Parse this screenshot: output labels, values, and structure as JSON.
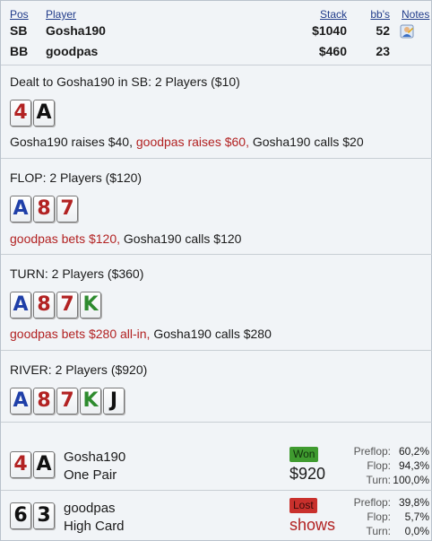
{
  "header": {
    "pos": "Pos",
    "player": "Player",
    "stack": "Stack",
    "bbs": "bb's",
    "notes": "Notes"
  },
  "players": [
    {
      "pos": "SB",
      "name": "Gosha190",
      "stack": "$1040",
      "bb": "52",
      "note_icon": "user-note-icon"
    },
    {
      "pos": "BB",
      "name": "goodpas",
      "stack": "$460",
      "bb": "23"
    }
  ],
  "preflop": {
    "title": "Dealt to Gosha190 in SB: 2 Players ($10)",
    "cards": [
      {
        "rank": "4",
        "color": "#b22222"
      },
      {
        "rank": "A",
        "color": "#111111"
      }
    ],
    "actions": [
      {
        "text": "Gosha190 raises $40, ",
        "who": "hero"
      },
      {
        "text": "goodpas raises $60, ",
        "who": "villain"
      },
      {
        "text": "Gosha190 calls $20",
        "who": "hero"
      }
    ]
  },
  "flop": {
    "title": "FLOP: 2 Players ($120)",
    "cards": [
      {
        "rank": "A",
        "color": "#1f3fa8"
      },
      {
        "rank": "8",
        "color": "#b22222"
      },
      {
        "rank": "7",
        "color": "#b22222"
      }
    ],
    "actions": [
      {
        "text": "goodpas bets $120, ",
        "who": "villain"
      },
      {
        "text": "Gosha190 calls $120",
        "who": "hero"
      }
    ]
  },
  "turn": {
    "title": "TURN: 2 Players ($360)",
    "cards": [
      {
        "rank": "A",
        "color": "#1f3fa8"
      },
      {
        "rank": "8",
        "color": "#b22222"
      },
      {
        "rank": "7",
        "color": "#b22222"
      },
      {
        "rank": "K",
        "color": "#2e8b2e"
      }
    ],
    "actions": [
      {
        "text": "goodpas bets $280 all-in, ",
        "who": "villain"
      },
      {
        "text": "Gosha190 calls $280",
        "who": "hero"
      }
    ]
  },
  "river": {
    "title": "RIVER: 2 Players ($920)",
    "cards": [
      {
        "rank": "A",
        "color": "#1f3fa8"
      },
      {
        "rank": "8",
        "color": "#b22222"
      },
      {
        "rank": "7",
        "color": "#b22222"
      },
      {
        "rank": "K",
        "color": "#2e8b2e"
      },
      {
        "rank": "J",
        "color": "#111111"
      }
    ]
  },
  "results": [
    {
      "cards": [
        {
          "rank": "4",
          "color": "#b22222"
        },
        {
          "rank": "A",
          "color": "#111111"
        }
      ],
      "name": "Gosha190",
      "hand": "One Pair",
      "badge": "Won",
      "badge_type": "won",
      "amount": "$920",
      "amount_color": "#1a1a1a",
      "stats": [
        {
          "label": "Preflop:",
          "value": "60,2%"
        },
        {
          "label": "Flop:",
          "value": "94,3%"
        },
        {
          "label": "Turn:",
          "value": "100,0%"
        }
      ]
    },
    {
      "cards": [
        {
          "rank": "6",
          "color": "#111111"
        },
        {
          "rank": "3",
          "color": "#111111"
        }
      ],
      "name": "goodpas",
      "hand": "High Card",
      "badge": "Lost",
      "badge_type": "lost",
      "amount": "shows",
      "amount_color": "#b22222",
      "stats": [
        {
          "label": "Preflop:",
          "value": "39,8%"
        },
        {
          "label": "Flop:",
          "value": "5,7%"
        },
        {
          "label": "Turn:",
          "value": "0,0%"
        }
      ]
    }
  ]
}
